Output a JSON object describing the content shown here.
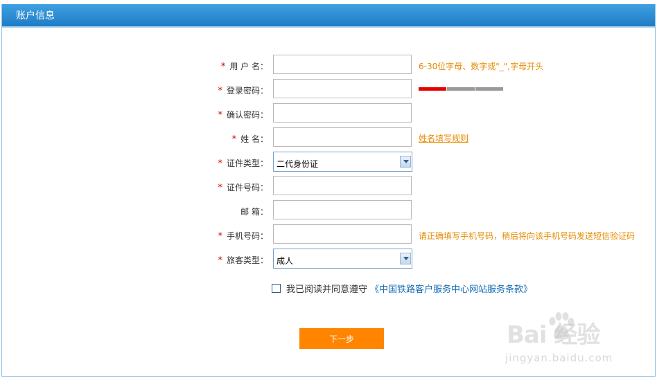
{
  "header": {
    "title": "账户信息"
  },
  "form": {
    "username": {
      "label": "用 户 名：",
      "value": "",
      "hint": "6-30位字母、数字或\"_\",字母开头"
    },
    "password": {
      "label": "登录密码：",
      "value": "",
      "strength_colors": [
        "#e60000",
        "#999999",
        "#999999"
      ]
    },
    "confirm_password": {
      "label": "确认密码：",
      "value": ""
    },
    "name": {
      "label": "姓 名：",
      "value": "",
      "link": "姓名填写规则"
    },
    "id_type": {
      "label": "证件类型：",
      "selected": "二代身份证"
    },
    "id_number": {
      "label": "证件号码：",
      "value": ""
    },
    "email": {
      "label": "邮 箱：",
      "value": ""
    },
    "phone": {
      "label": "手机号码：",
      "value": "",
      "hint": "请正确填写手机号码，稍后将向该手机号码发送短信验证码"
    },
    "passenger_type": {
      "label": "旅客类型：",
      "selected": "成人"
    },
    "required_mark": "*"
  },
  "agreement": {
    "text": "我已阅读并同意遵守",
    "link": "《中国铁路客户服务中心网站服务条款》",
    "checked": false
  },
  "next_button": {
    "label": "下一步"
  },
  "watermark": {
    "main": "Bai   经验",
    "sub": "jingyan.baidu.com"
  },
  "colors": {
    "accent": "#ff8400",
    "header": "#2a8ad4",
    "hint": "#e68a00",
    "required": "#d00000",
    "link": "#1a6fb5"
  }
}
